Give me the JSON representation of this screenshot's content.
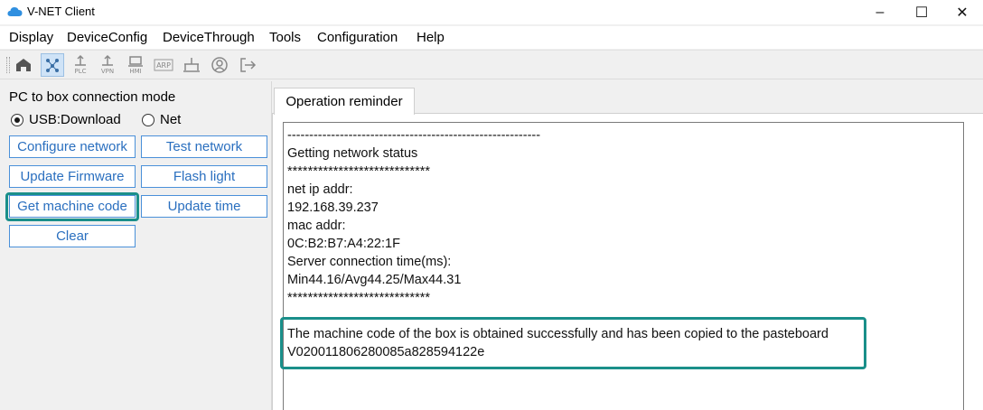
{
  "window": {
    "title": "V-NET Client",
    "controls": [
      "–",
      "☐",
      "✕"
    ]
  },
  "menubar": {
    "items": [
      "Display",
      "DeviceConfig",
      "DeviceThrough",
      "Tools",
      "Configuration",
      "Help"
    ]
  },
  "toolbar": {
    "buttons": [
      {
        "icon": "home-icon",
        "label": ""
      },
      {
        "icon": "network-icon",
        "label": ""
      },
      {
        "icon": "plc-icon",
        "label": "PLC"
      },
      {
        "icon": "vpn-icon",
        "label": "VPN"
      },
      {
        "icon": "hmi-icon",
        "label": "HMI"
      },
      {
        "icon": "arp-icon",
        "label": "ARP"
      },
      {
        "icon": "lan-icon",
        "label": ""
      },
      {
        "icon": "user-icon",
        "label": ""
      },
      {
        "icon": "logout-icon",
        "label": ""
      }
    ]
  },
  "connection": {
    "title": "PC to box connection mode",
    "options": [
      "USB:Download",
      "Net"
    ],
    "selected": "USB:Download"
  },
  "actions": {
    "configure_network": "Configure network",
    "test_network": "Test network",
    "update_firmware": "Update Firmware",
    "flash_light": "Flash light",
    "get_machine_code": "Get machine code",
    "update_time": "Update time",
    "clear": "Clear"
  },
  "reminder": {
    "tab": "Operation reminder",
    "lines": [
      "----------------------------------------------------------",
      "Getting network status",
      "****************************",
      "net ip addr:",
      "192.168.39.237",
      "mac addr:",
      "0C:B2:B7:A4:22:1F",
      "Server connection time(ms):",
      "Min44.16/Avg44.25/Max44.31",
      "****************************",
      "",
      "The machine code of the box is obtained successfully and has been copied to the pasteboard",
      "V020011806280085a828594122e"
    ]
  },
  "colors": {
    "accent": "#1a8f8a",
    "button_border": "#4a90d9",
    "button_text": "#2a6fbf"
  }
}
